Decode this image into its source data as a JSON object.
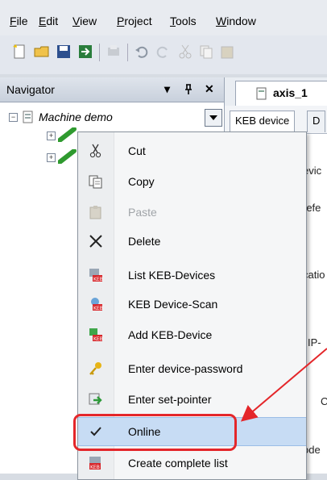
{
  "menubar": {
    "items": [
      {
        "label": "File",
        "accel": "F",
        "rest": "ile"
      },
      {
        "label": "Edit",
        "accel": "E",
        "rest": "dit"
      },
      {
        "label": "View",
        "accel": "V",
        "rest": "iew"
      },
      {
        "label": "Project",
        "accel": "P",
        "rest": "roject"
      },
      {
        "label": "Tools",
        "accel": "T",
        "rest": "ools"
      },
      {
        "label": "Window",
        "accel": "W",
        "rest": "indow"
      }
    ]
  },
  "toolbar": {
    "icons": [
      "new-icon",
      "open-folder-icon",
      "save-icon",
      "import-icon",
      "print-icon",
      "undo-icon",
      "redo-icon",
      "cut-icon",
      "copy-icon",
      "paste-icon"
    ]
  },
  "navigator": {
    "title": "Navigator",
    "pin_glyph": "▾",
    "pushpin_glyph": "ᵖ",
    "close_glyph": "✕",
    "root_label": "Machine demo"
  },
  "document": {
    "tab_title": "axis_1",
    "subtab_1": "KEB device",
    "subtab_2": "D",
    "fragments": {
      "f1": "evic",
      "f2": "refe",
      "f3": "catio",
      "f4": "IP-",
      "f5": "C",
      "f6": "ode"
    }
  },
  "context_menu": {
    "items": [
      {
        "label": "Cut",
        "icon": "cut-icon",
        "disabled": false
      },
      {
        "label": "Copy",
        "icon": "copy-icon",
        "disabled": false
      },
      {
        "label": "Paste",
        "icon": "paste-icon",
        "disabled": true
      },
      {
        "label": "Delete",
        "icon": "delete-icon",
        "disabled": false
      },
      {
        "label": "List KEB-Devices",
        "icon": "keb-list-icon",
        "disabled": false
      },
      {
        "label": "KEB Device-Scan",
        "icon": "keb-scan-icon",
        "disabled": false
      },
      {
        "label": "Add KEB-Device",
        "icon": "keb-add-icon",
        "disabled": false
      },
      {
        "label": "Enter device-password",
        "icon": "key-icon",
        "disabled": false
      },
      {
        "label": "Enter set-pointer",
        "icon": "set-pointer-icon",
        "disabled": false
      },
      {
        "label": "Online",
        "icon": "checkmark-icon",
        "disabled": false,
        "checked": true
      },
      {
        "label": "Create complete list",
        "icon": "keb-complete-list-icon",
        "disabled": false
      }
    ]
  },
  "colors": {
    "highlight": "#c7dcf4",
    "annotation": "#e4262a"
  }
}
